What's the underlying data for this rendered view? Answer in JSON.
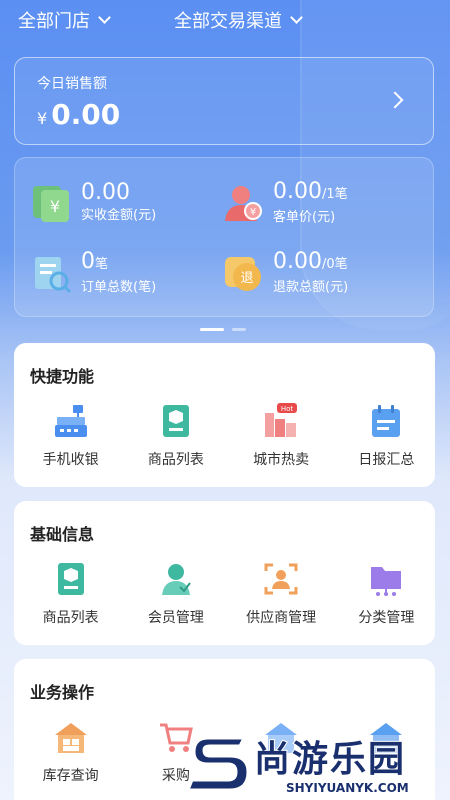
{
  "header": {
    "store_filter": "全部门店",
    "channel_filter": "全部交易渠道"
  },
  "sales": {
    "label": "今日销售额",
    "currency": "¥",
    "value": "0.00"
  },
  "stats": [
    {
      "value": "0.00",
      "suffix": "",
      "label": "实收金额(元)",
      "icon": "cash-receipt-icon"
    },
    {
      "value": "0.00",
      "suffix": "/1笔",
      "label": "客单价(元)",
      "icon": "customer-price-icon"
    },
    {
      "value": "0",
      "suffix": "笔",
      "label": "订单总数(笔)",
      "icon": "order-search-icon"
    },
    {
      "value": "0.00",
      "suffix": "/0笔",
      "label": "退款总额(元)",
      "icon": "refund-icon"
    }
  ],
  "quick": {
    "title": "快捷功能",
    "items": [
      {
        "label": "手机收银",
        "icon": "cash-register-icon"
      },
      {
        "label": "商品列表",
        "icon": "product-list-icon"
      },
      {
        "label": "城市热卖",
        "icon": "city-hot-icon",
        "badge": "Hot"
      },
      {
        "label": "日报汇总",
        "icon": "daily-report-icon"
      }
    ]
  },
  "basic": {
    "title": "基础信息",
    "items": [
      {
        "label": "商品列表",
        "icon": "product-list-icon"
      },
      {
        "label": "会员管理",
        "icon": "member-icon"
      },
      {
        "label": "供应商管理",
        "icon": "supplier-icon"
      },
      {
        "label": "分类管理",
        "icon": "category-icon"
      }
    ]
  },
  "ops": {
    "title": "业务操作",
    "items": [
      {
        "label": "库存查询",
        "icon": "inventory-icon"
      },
      {
        "label": "采购",
        "icon": "purchase-icon"
      }
    ]
  },
  "watermark": {
    "cn": "尚游乐园",
    "en": "SHYIYUANYK.COM"
  },
  "colors": {
    "bg_top": "#5b8ff2",
    "teal": "#3fb8a0",
    "orange": "#f0a05a",
    "purple": "#9b7ce8",
    "blue": "#4a8ff0"
  }
}
